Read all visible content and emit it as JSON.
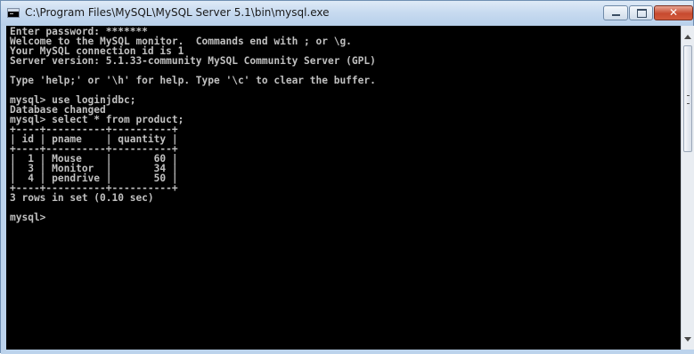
{
  "window": {
    "title": "C:\\Program Files\\MySQL\\MySQL Server 5.1\\bin\\mysql.exe",
    "close_glyph": "✕"
  },
  "console": {
    "lines": [
      "Enter password: *******",
      "Welcome to the MySQL monitor.  Commands end with ; or \\g.",
      "Your MySQL connection id is 1",
      "Server version: 5.1.33-community MySQL Community Server (GPL)",
      "",
      "Type 'help;' or '\\h' for help. Type '\\c' to clear the buffer.",
      "",
      "mysql> use loginjdbc;",
      "Database changed",
      "mysql> select * from product;",
      "+----+----------+----------+",
      "| id | pname    | quantity |",
      "+----+----------+----------+",
      "|  1 | Mouse    |       60 |",
      "|  3 | Monitor  |       34 |",
      "|  4 | pendrive |       50 |",
      "+----+----------+----------+",
      "3 rows in set (0.10 sec)",
      "",
      "mysql>"
    ]
  }
}
